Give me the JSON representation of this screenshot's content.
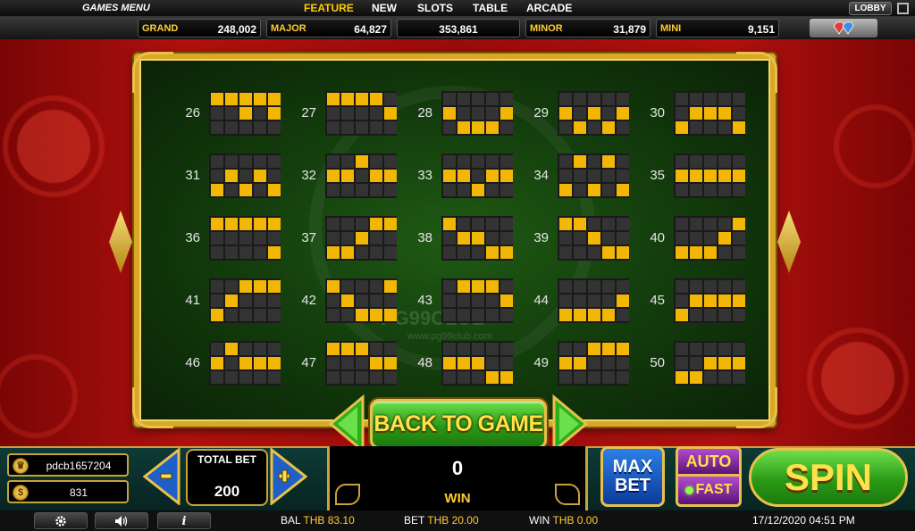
{
  "nav": {
    "games_menu": "GAMES MENU",
    "tabs": [
      {
        "label": "FEATURE",
        "active": true
      },
      {
        "label": "NEW",
        "active": false
      },
      {
        "label": "SLOTS",
        "active": false
      },
      {
        "label": "TABLE",
        "active": false
      },
      {
        "label": "ARCADE",
        "active": false
      }
    ],
    "lobby": "LOBBY"
  },
  "jackpots": {
    "grand": {
      "label": "GRAND",
      "value": "248,002"
    },
    "major": {
      "label": "MAJOR",
      "value": "64,827"
    },
    "main_value": "353,861",
    "minor": {
      "label": "MINOR",
      "value": "31,879"
    },
    "mini": {
      "label": "MINI",
      "value": "9,151"
    }
  },
  "watermark": {
    "text": "PG99CLUB",
    "url": "www.pg99club.com"
  },
  "paylines": [
    {
      "num": "26",
      "rows": [
        "11111",
        "00101",
        "00000"
      ]
    },
    {
      "num": "27",
      "rows": [
        "11110",
        "00001",
        "00000"
      ]
    },
    {
      "num": "28",
      "rows": [
        "00000",
        "10001",
        "01110"
      ]
    },
    {
      "num": "29",
      "rows": [
        "00000",
        "10101",
        "01010"
      ]
    },
    {
      "num": "30",
      "rows": [
        "00000",
        "01110",
        "10001"
      ]
    },
    {
      "num": "31",
      "rows": [
        "00000",
        "01010",
        "10101"
      ]
    },
    {
      "num": "32",
      "rows": [
        "00100",
        "11011",
        "00000"
      ]
    },
    {
      "num": "33",
      "rows": [
        "00000",
        "11011",
        "00100"
      ]
    },
    {
      "num": "34",
      "rows": [
        "01010",
        "00000",
        "10101"
      ]
    },
    {
      "num": "35",
      "rows": [
        "00000",
        "11111",
        "00000"
      ]
    },
    {
      "num": "36",
      "rows": [
        "11111",
        "00000",
        "00001"
      ]
    },
    {
      "num": "37",
      "rows": [
        "00011",
        "00100",
        "11000"
      ]
    },
    {
      "num": "38",
      "rows": [
        "10000",
        "01100",
        "00011"
      ]
    },
    {
      "num": "39",
      "rows": [
        "11000",
        "00100",
        "00011"
      ]
    },
    {
      "num": "40",
      "rows": [
        "00001",
        "00010",
        "11100"
      ]
    },
    {
      "num": "41",
      "rows": [
        "00111",
        "01000",
        "10000"
      ]
    },
    {
      "num": "42",
      "rows": [
        "10001",
        "01000",
        "00111"
      ]
    },
    {
      "num": "43",
      "rows": [
        "01110",
        "00001",
        "00000"
      ]
    },
    {
      "num": "44",
      "rows": [
        "00000",
        "00001",
        "11110"
      ]
    },
    {
      "num": "45",
      "rows": [
        "00000",
        "01111",
        "10000"
      ]
    },
    {
      "num": "46",
      "rows": [
        "01000",
        "10111",
        "00000"
      ]
    },
    {
      "num": "47",
      "rows": [
        "11100",
        "00011",
        "00000"
      ]
    },
    {
      "num": "48",
      "rows": [
        "00000",
        "11100",
        "00011"
      ]
    },
    {
      "num": "49",
      "rows": [
        "00111",
        "11000",
        "00000"
      ]
    },
    {
      "num": "50",
      "rows": [
        "00000",
        "00111",
        "11000"
      ]
    }
  ],
  "back_to_game": "BACK TO GAME",
  "player": {
    "username": "pdcb1657204",
    "coin_symbol": "$",
    "credits": "831"
  },
  "total_bet": {
    "label": "TOTAL BET",
    "value": "200"
  },
  "win": {
    "value": "0",
    "label": "WIN"
  },
  "buttons": {
    "max_bet": "MAX BET",
    "auto": "AUTO",
    "fast": "FAST",
    "spin": "SPIN",
    "minus": "-",
    "plus": "+"
  },
  "status": {
    "bal_label": "BAL",
    "bal_value": "THB 83.10",
    "bet_label": "BET",
    "bet_value": "THB 20.00",
    "win_label": "WIN",
    "win_value": "THB 0.00",
    "datetime": "17/12/2020 04:51 PM"
  },
  "colors": {
    "gold": "#e8c14a",
    "green_felt": "#143f0d",
    "red_bg": "#a80f0c",
    "line_on": "#f2b705"
  }
}
